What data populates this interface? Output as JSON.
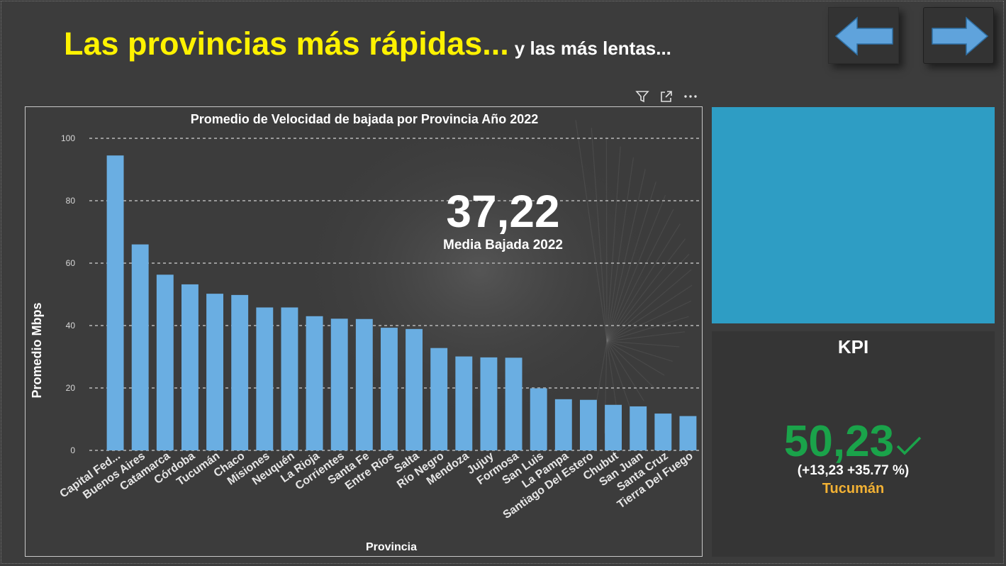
{
  "header": {
    "title_main": "Las provincias más rápidas...",
    "title_sub": "y las más lentas..."
  },
  "nav": {
    "back_icon": "arrow-left-icon",
    "forward_icon": "arrow-right-icon",
    "arrow_color": "#5fa3dc"
  },
  "visual_header": {
    "filter_icon": "filter-icon",
    "focus_icon": "focus-mode-icon",
    "more_icon": "more-options-icon"
  },
  "chart_data": {
    "type": "bar",
    "title": "Promedio de Velocidad de bajada por Provincia Año 2022",
    "xlabel": "Provincia",
    "ylabel": "Promedio Mbps",
    "ylim": [
      0,
      100
    ],
    "yticks": [
      0,
      20,
      40,
      60,
      80,
      100
    ],
    "grid": true,
    "bar_color": "#6aaee2",
    "categories": [
      "Capital Fed...",
      "Buenos Aires",
      "Catamarca",
      "Córdoba",
      "Tucumán",
      "Chaco",
      "Misiones",
      "Neuquén",
      "La Rioja",
      "Corrientes",
      "Santa Fe",
      "Entre Ríos",
      "Salta",
      "Río Negro",
      "Mendoza",
      "Jujuy",
      "Formosa",
      "San Luis",
      "La Pampa",
      "Santiago Del Estero",
      "Chubut",
      "San Juan",
      "Santa Cruz",
      "Tierra Del Fuego"
    ],
    "values": [
      94.5,
      66.0,
      56.3,
      53.2,
      50.2,
      49.8,
      45.8,
      45.8,
      43.0,
      42.2,
      42.1,
      39.3,
      38.9,
      32.8,
      30.1,
      29.8,
      29.7,
      19.9,
      16.4,
      16.2,
      14.6,
      14.1,
      11.8,
      11.0
    ]
  },
  "card": {
    "value": "37,22",
    "label": "Media Bajada 2022",
    "background": "#2e9dc4"
  },
  "kpi": {
    "title": "KPI",
    "value": "50,23",
    "delta": "(+13,23 +35.77 %)",
    "goal_label": "Tucumán",
    "status_icon": "checkmark-icon",
    "value_color": "#1aa34a",
    "goal_color": "#f2b134"
  }
}
